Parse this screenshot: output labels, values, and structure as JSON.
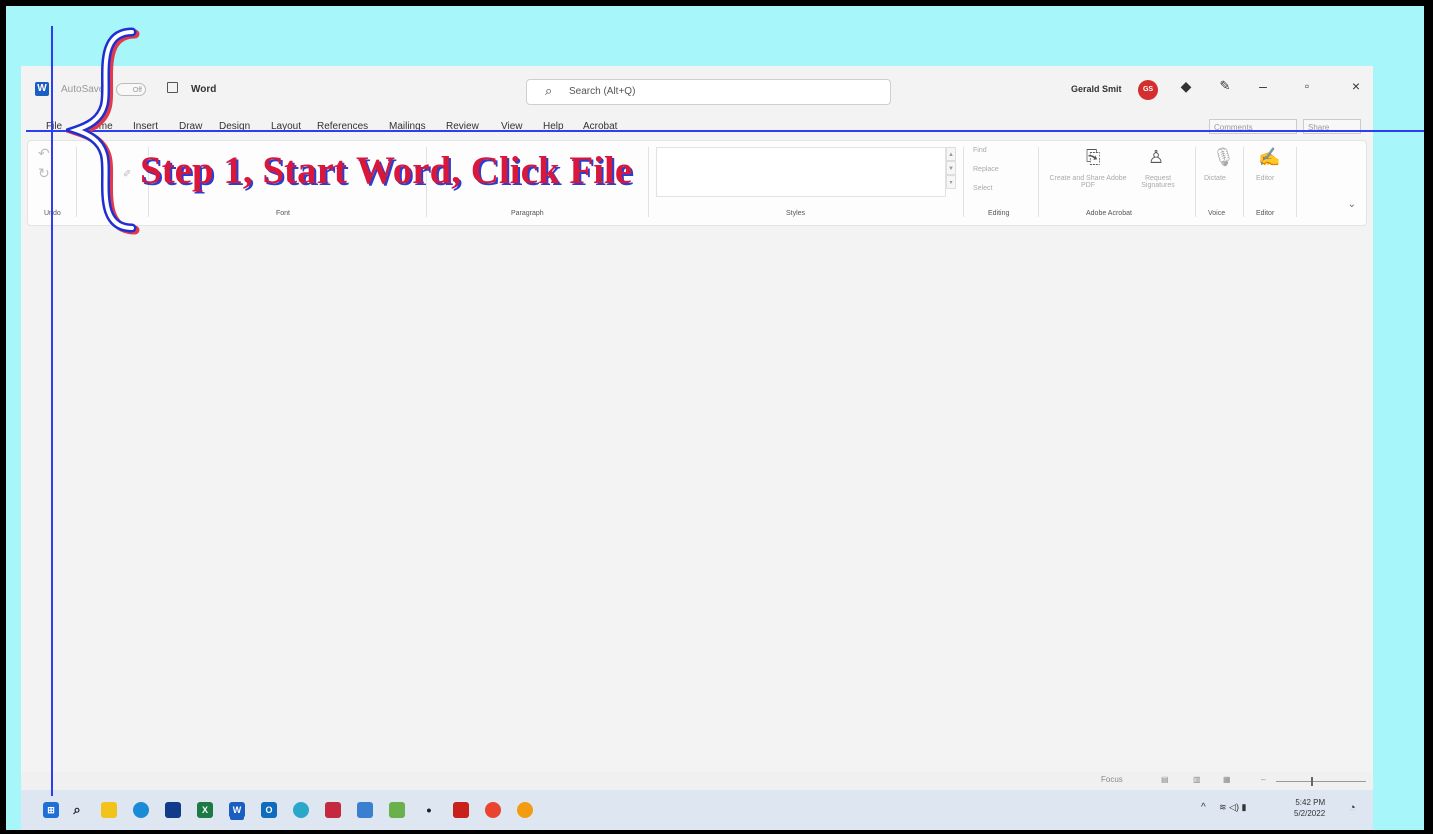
{
  "annotation": {
    "caption": "Step 1, Start Word, Click File"
  },
  "title_bar": {
    "autosave_label": "AutoSave",
    "autosave_state": "Off",
    "doc_title": "Word",
    "search_placeholder": "Search (Alt+Q)",
    "user_name": "Gerald Smit",
    "user_initials": "GS",
    "minimize": "–",
    "restore": "▫",
    "close": "×"
  },
  "ribbon_tabs": [
    "File",
    "Home",
    "Insert",
    "Draw",
    "Design",
    "Layout",
    "References",
    "Mailings",
    "Review",
    "View",
    "Help",
    "Acrobat"
  ],
  "ribbon_actions": {
    "comments": "Comments",
    "share": "Share"
  },
  "ribbon": {
    "groups": {
      "undo": "Undo",
      "font": "Font",
      "paragraph": "Paragraph",
      "styles": "Styles",
      "editing": "Editing",
      "adobe_acrobat": "Adobe Acrobat",
      "voice": "Voice",
      "editor": "Editor"
    },
    "editing_items": [
      "Find",
      "Replace",
      "Select"
    ],
    "acrobat_buttons": {
      "create_share": "Create and Share Adobe PDF",
      "request_signatures": "Request Signatures"
    },
    "dictate": "Dictate",
    "editor_button": "Editor"
  },
  "status_bar": {
    "focus": "Focus"
  },
  "taskbar": {
    "time": "5:42 PM",
    "date": "5/2/2022"
  },
  "colors": {
    "background": "#a6f6fa",
    "caption": "#d8173a",
    "annotation_lines": "#2b3df5",
    "word_blue": "#1b5ec2"
  }
}
